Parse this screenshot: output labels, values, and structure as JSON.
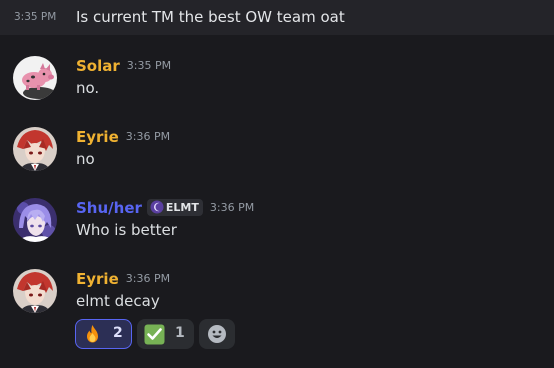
{
  "messages": {
    "compact": {
      "time": "3:35 PM",
      "text": "Is current TM the best OW team oat"
    },
    "m1": {
      "author": "Solar",
      "author_color": "#f0b232",
      "time": "3:35 PM",
      "text": "no.",
      "avatar_icon": "pig-avatar"
    },
    "m2": {
      "author": "Eyrie",
      "author_color": "#f0b232",
      "time": "3:36 PM",
      "text": "no",
      "avatar_icon": "anime-character-avatar"
    },
    "m3": {
      "author": "Shu/her",
      "author_color": "#5865f2",
      "tag": "ELMT",
      "tag_icon": "crescent-moon-icon",
      "time": "3:36 PM",
      "text": "Who is better",
      "avatar_icon": "anime-character-avatar"
    },
    "m4": {
      "author": "Eyrie",
      "author_color": "#f0b232",
      "time": "3:36 PM",
      "text": "elmt decay",
      "avatar_icon": "anime-character-avatar",
      "reactions": [
        {
          "emoji": "fire",
          "count": "2",
          "active": true
        },
        {
          "emoji": "white-check-mark",
          "count": "1",
          "active": false
        }
      ],
      "add_reaction_icon": "smiley-face-icon"
    }
  },
  "colors": {
    "background": "#1a1a1e",
    "compact_highlight": "#242429",
    "reaction_active_border": "#5865f2"
  }
}
